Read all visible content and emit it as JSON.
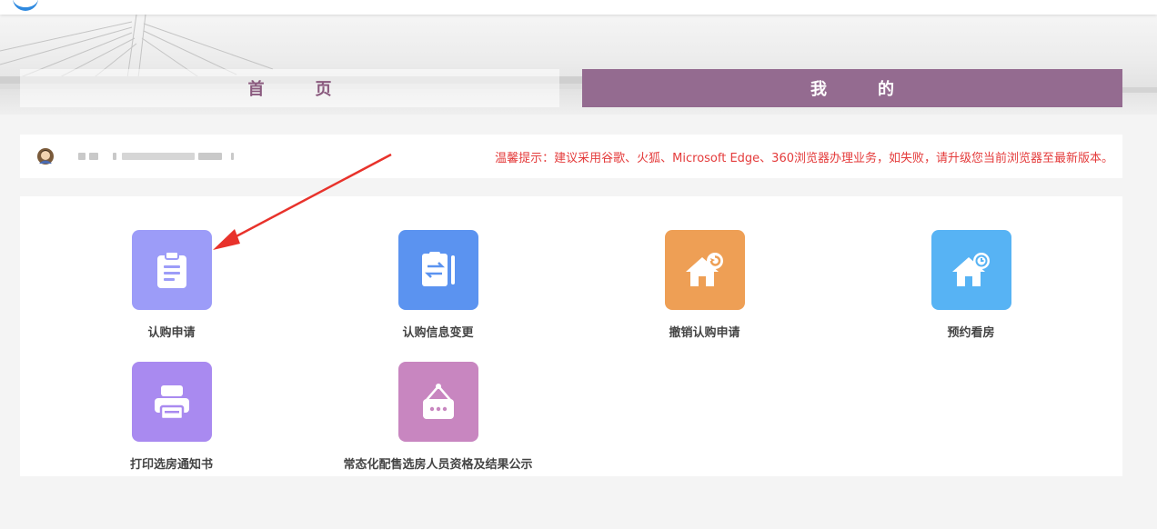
{
  "header": {
    "tabs": [
      {
        "label": "首页"
      },
      {
        "label": "我的"
      }
    ]
  },
  "userbar": {
    "notice": "温馨提示：建议采用谷歌、火狐、Microsoft Edge、360浏览器办理业务，如失败，请升级您当前浏览器至最新版本。"
  },
  "menu": {
    "items": [
      {
        "label": "认购申请",
        "icon": "clipboard-icon",
        "color": "#9c9cf8"
      },
      {
        "label": "认购信息变更",
        "icon": "exchange-document-icon",
        "color": "#5b93f0"
      },
      {
        "label": "撤销认购申请",
        "icon": "house-undo-icon",
        "color": "#ee9f55"
      },
      {
        "label": "预约看房",
        "icon": "house-clock-icon",
        "color": "#57b3f4"
      },
      {
        "label": "打印选房通知书",
        "icon": "printer-icon",
        "color": "#a98af0"
      },
      {
        "label": "常态化配售选房人员资格及结果公示",
        "icon": "notice-board-icon",
        "color": "#c886c0"
      }
    ]
  },
  "colors": {
    "accent": "#946b90",
    "notice": "#e43b3b",
    "annotation_arrow": "#e8322b"
  }
}
